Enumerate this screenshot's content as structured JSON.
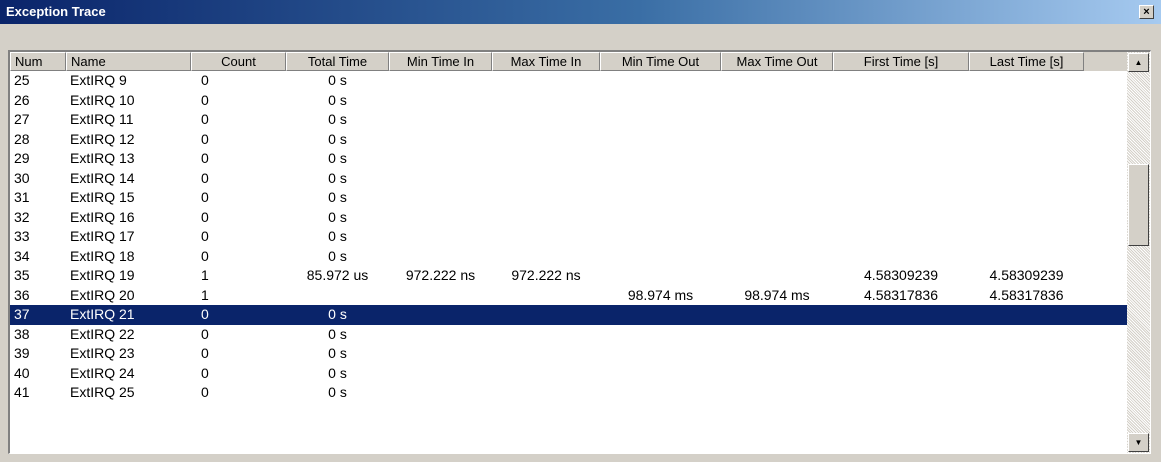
{
  "window": {
    "title": "Exception Trace",
    "close_label": "×"
  },
  "columns": [
    "Num",
    "Name",
    "Count",
    "Total Time",
    "Min Time In",
    "Max Time In",
    "Min Time Out",
    "Max Time Out",
    "First Time [s]",
    "Last Time [s]"
  ],
  "rows": [
    {
      "num": "25",
      "name": "ExtIRQ 9",
      "count": "0",
      "total": "0 s",
      "min_in": "",
      "max_in": "",
      "min_out": "",
      "max_out": "",
      "first": "",
      "last": ""
    },
    {
      "num": "26",
      "name": "ExtIRQ 10",
      "count": "0",
      "total": "0 s",
      "min_in": "",
      "max_in": "",
      "min_out": "",
      "max_out": "",
      "first": "",
      "last": ""
    },
    {
      "num": "27",
      "name": "ExtIRQ 11",
      "count": "0",
      "total": "0 s",
      "min_in": "",
      "max_in": "",
      "min_out": "",
      "max_out": "",
      "first": "",
      "last": ""
    },
    {
      "num": "28",
      "name": "ExtIRQ 12",
      "count": "0",
      "total": "0 s",
      "min_in": "",
      "max_in": "",
      "min_out": "",
      "max_out": "",
      "first": "",
      "last": ""
    },
    {
      "num": "29",
      "name": "ExtIRQ 13",
      "count": "0",
      "total": "0 s",
      "min_in": "",
      "max_in": "",
      "min_out": "",
      "max_out": "",
      "first": "",
      "last": ""
    },
    {
      "num": "30",
      "name": "ExtIRQ 14",
      "count": "0",
      "total": "0 s",
      "min_in": "",
      "max_in": "",
      "min_out": "",
      "max_out": "",
      "first": "",
      "last": ""
    },
    {
      "num": "31",
      "name": "ExtIRQ 15",
      "count": "0",
      "total": "0 s",
      "min_in": "",
      "max_in": "",
      "min_out": "",
      "max_out": "",
      "first": "",
      "last": ""
    },
    {
      "num": "32",
      "name": "ExtIRQ 16",
      "count": "0",
      "total": "0 s",
      "min_in": "",
      "max_in": "",
      "min_out": "",
      "max_out": "",
      "first": "",
      "last": ""
    },
    {
      "num": "33",
      "name": "ExtIRQ 17",
      "count": "0",
      "total": "0 s",
      "min_in": "",
      "max_in": "",
      "min_out": "",
      "max_out": "",
      "first": "",
      "last": ""
    },
    {
      "num": "34",
      "name": "ExtIRQ 18",
      "count": "0",
      "total": "0 s",
      "min_in": "",
      "max_in": "",
      "min_out": "",
      "max_out": "",
      "first": "",
      "last": ""
    },
    {
      "num": "35",
      "name": "ExtIRQ 19",
      "count": "1",
      "total": "85.972 us",
      "min_in": "972.222 ns",
      "max_in": "972.222 ns",
      "min_out": "",
      "max_out": "",
      "first": "4.58309239",
      "last": "4.58309239"
    },
    {
      "num": "36",
      "name": "ExtIRQ 20",
      "count": "1",
      "total": "",
      "min_in": "",
      "max_in": "",
      "min_out": "98.974 ms",
      "max_out": "98.974 ms",
      "first": "4.58317836",
      "last": "4.58317836"
    },
    {
      "num": "37",
      "name": "ExtIRQ 21",
      "count": "0",
      "total": "0 s",
      "min_in": "",
      "max_in": "",
      "min_out": "",
      "max_out": "",
      "first": "",
      "last": "",
      "selected": true
    },
    {
      "num": "38",
      "name": "ExtIRQ 22",
      "count": "0",
      "total": "0 s",
      "min_in": "",
      "max_in": "",
      "min_out": "",
      "max_out": "",
      "first": "",
      "last": ""
    },
    {
      "num": "39",
      "name": "ExtIRQ 23",
      "count": "0",
      "total": "0 s",
      "min_in": "",
      "max_in": "",
      "min_out": "",
      "max_out": "",
      "first": "",
      "last": ""
    },
    {
      "num": "40",
      "name": "ExtIRQ 24",
      "count": "0",
      "total": "0 s",
      "min_in": "",
      "max_in": "",
      "min_out": "",
      "max_out": "",
      "first": "",
      "last": ""
    },
    {
      "num": "41",
      "name": "ExtIRQ 25",
      "count": "0",
      "total": "0 s",
      "min_in": "",
      "max_in": "",
      "min_out": "",
      "max_out": "",
      "first": "",
      "last": ""
    }
  ],
  "scrollbar": {
    "up_icon": "▲",
    "down_icon": "▼"
  },
  "colors": {
    "selection": "#0a246a",
    "title_bar_start": "#0a246a",
    "title_bar_end": "#a6caf0"
  }
}
